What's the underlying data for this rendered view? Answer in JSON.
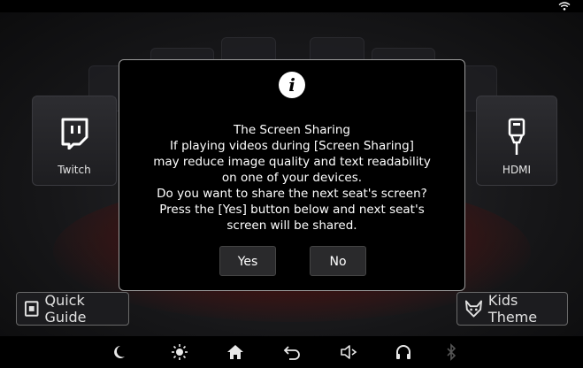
{
  "background": {
    "tiles": [
      {
        "id": "twitch",
        "label": "Twitch"
      },
      {
        "id": "hdmi",
        "label": "HDMI"
      }
    ],
    "quick_guide_label": "Quick Guide",
    "kids_theme_label": "Kids Theme"
  },
  "dialog": {
    "icon": "info-icon",
    "lines": [
      "The Screen Sharing",
      "If playing videos during [Screen Sharing]",
      "may reduce image quality and text readability",
      "on one of your devices.",
      "Do you want to share the next seat's screen?",
      "Press the [Yes] button below and next seat's",
      "screen will be shared."
    ],
    "yes_label": "Yes",
    "no_label": "No"
  },
  "bottom_bar": {
    "icons": [
      "moon-icon",
      "brightness-icon",
      "home-icon",
      "back-icon",
      "volume-icon",
      "headset-icon",
      "bluetooth-icon"
    ]
  },
  "colors": {
    "dialog_bg": "#000000",
    "accent_red": "#5a1d1d"
  }
}
